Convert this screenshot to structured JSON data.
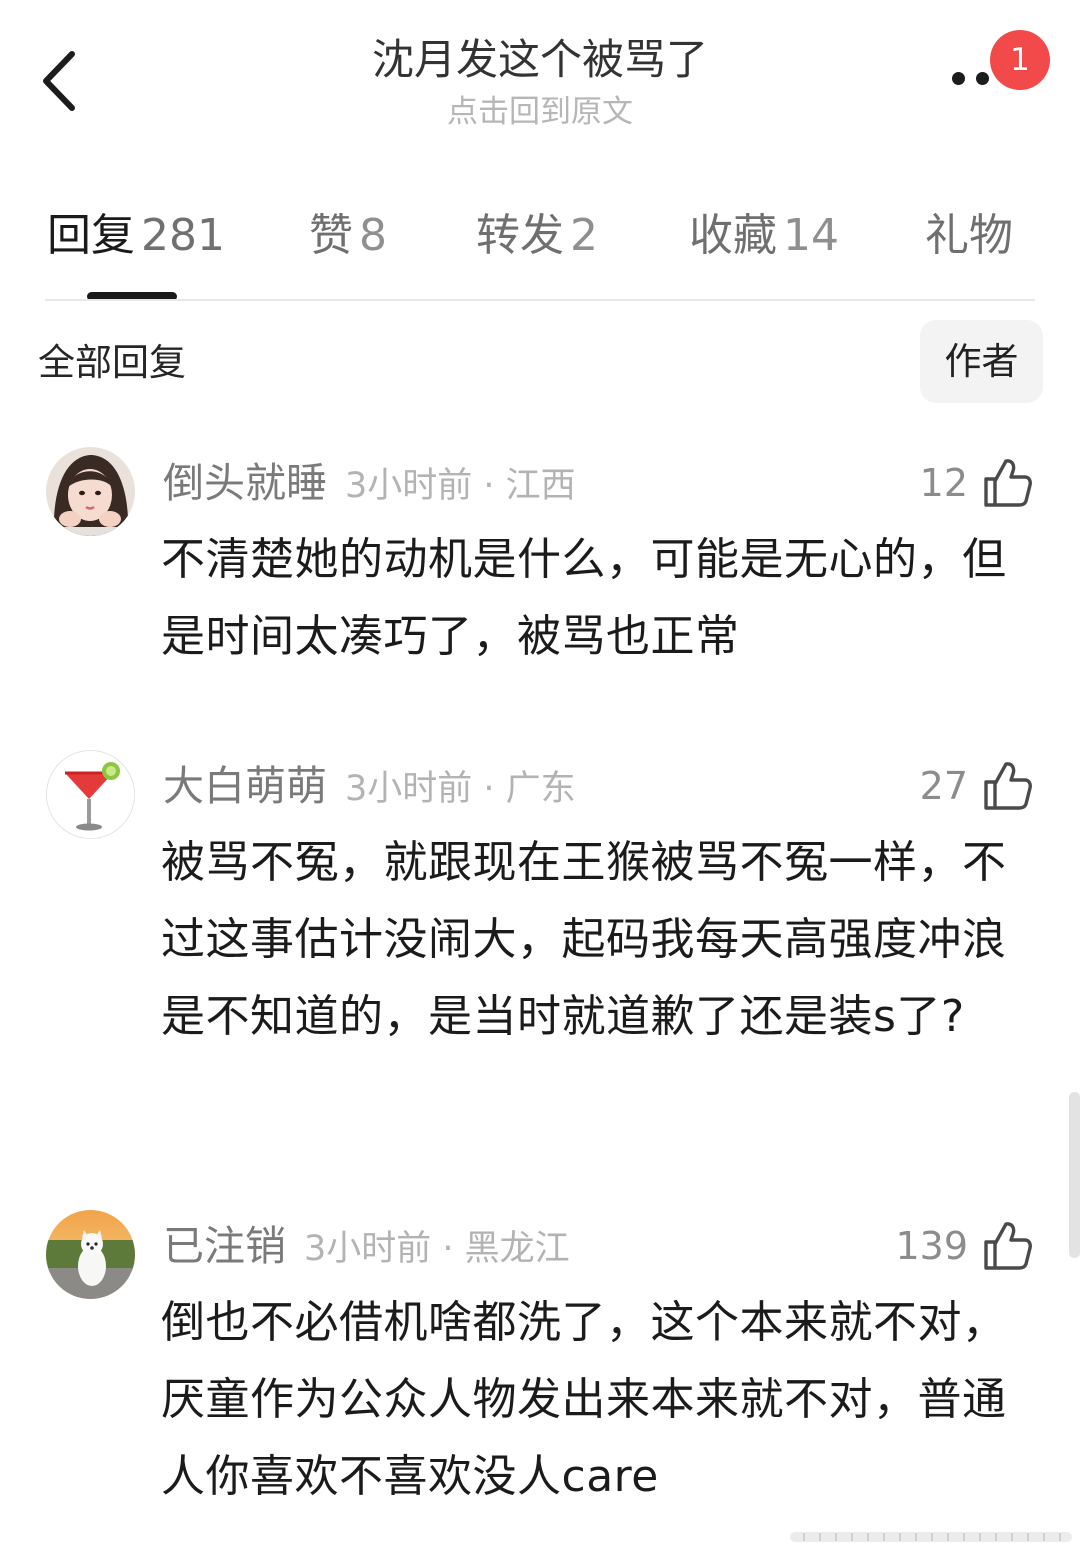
{
  "header": {
    "title": "沈月发这个被骂了",
    "subtitle": "点击回到原文",
    "badge": "1",
    "back_icon": "chevron-left-icon",
    "more_icon": "more-dots-icon"
  },
  "tabs": [
    {
      "label": "回复",
      "count": "281",
      "active": true
    },
    {
      "label": "赞",
      "count": "8",
      "active": false
    },
    {
      "label": "转发",
      "count": "2",
      "active": false
    },
    {
      "label": "收藏",
      "count": "14",
      "active": false
    },
    {
      "label": "礼物",
      "count": "",
      "active": false
    }
  ],
  "filter": {
    "label": "全部回复",
    "author_button": "作者"
  },
  "comments": [
    {
      "username": "倒头就睡",
      "time": "3小时前",
      "location": "江西",
      "likes": "12",
      "text": "不清楚她的动机是什么，可能是无心的，但是时间太凑巧了，被骂也正常",
      "avatar": "girl-portrait-avatar"
    },
    {
      "username": "大白萌萌",
      "time": "3小时前",
      "location": "广东",
      "likes": "27",
      "text": "被骂不冤，就跟现在王猴被骂不冤一样，不过这事估计没闹大，起码我每天高强度冲浪是不知道的，是当时就道歉了还是装s了?",
      "avatar": "cocktail-glass-avatar"
    },
    {
      "username": "已注销",
      "time": "3小时前",
      "location": "黑龙江",
      "likes": "139",
      "text": "倒也不必借机啥都洗了，这个本来就不对，厌童作为公众人物发出来本来就不对，普通人你喜欢不喜欢没人care",
      "avatar": "white-dog-avatar"
    }
  ],
  "colors": {
    "badge": "#f24a4a",
    "active_tab": "#1a1a1a",
    "inactive_tab": "#6f6f6f",
    "meta_text": "#b3b3b3"
  }
}
